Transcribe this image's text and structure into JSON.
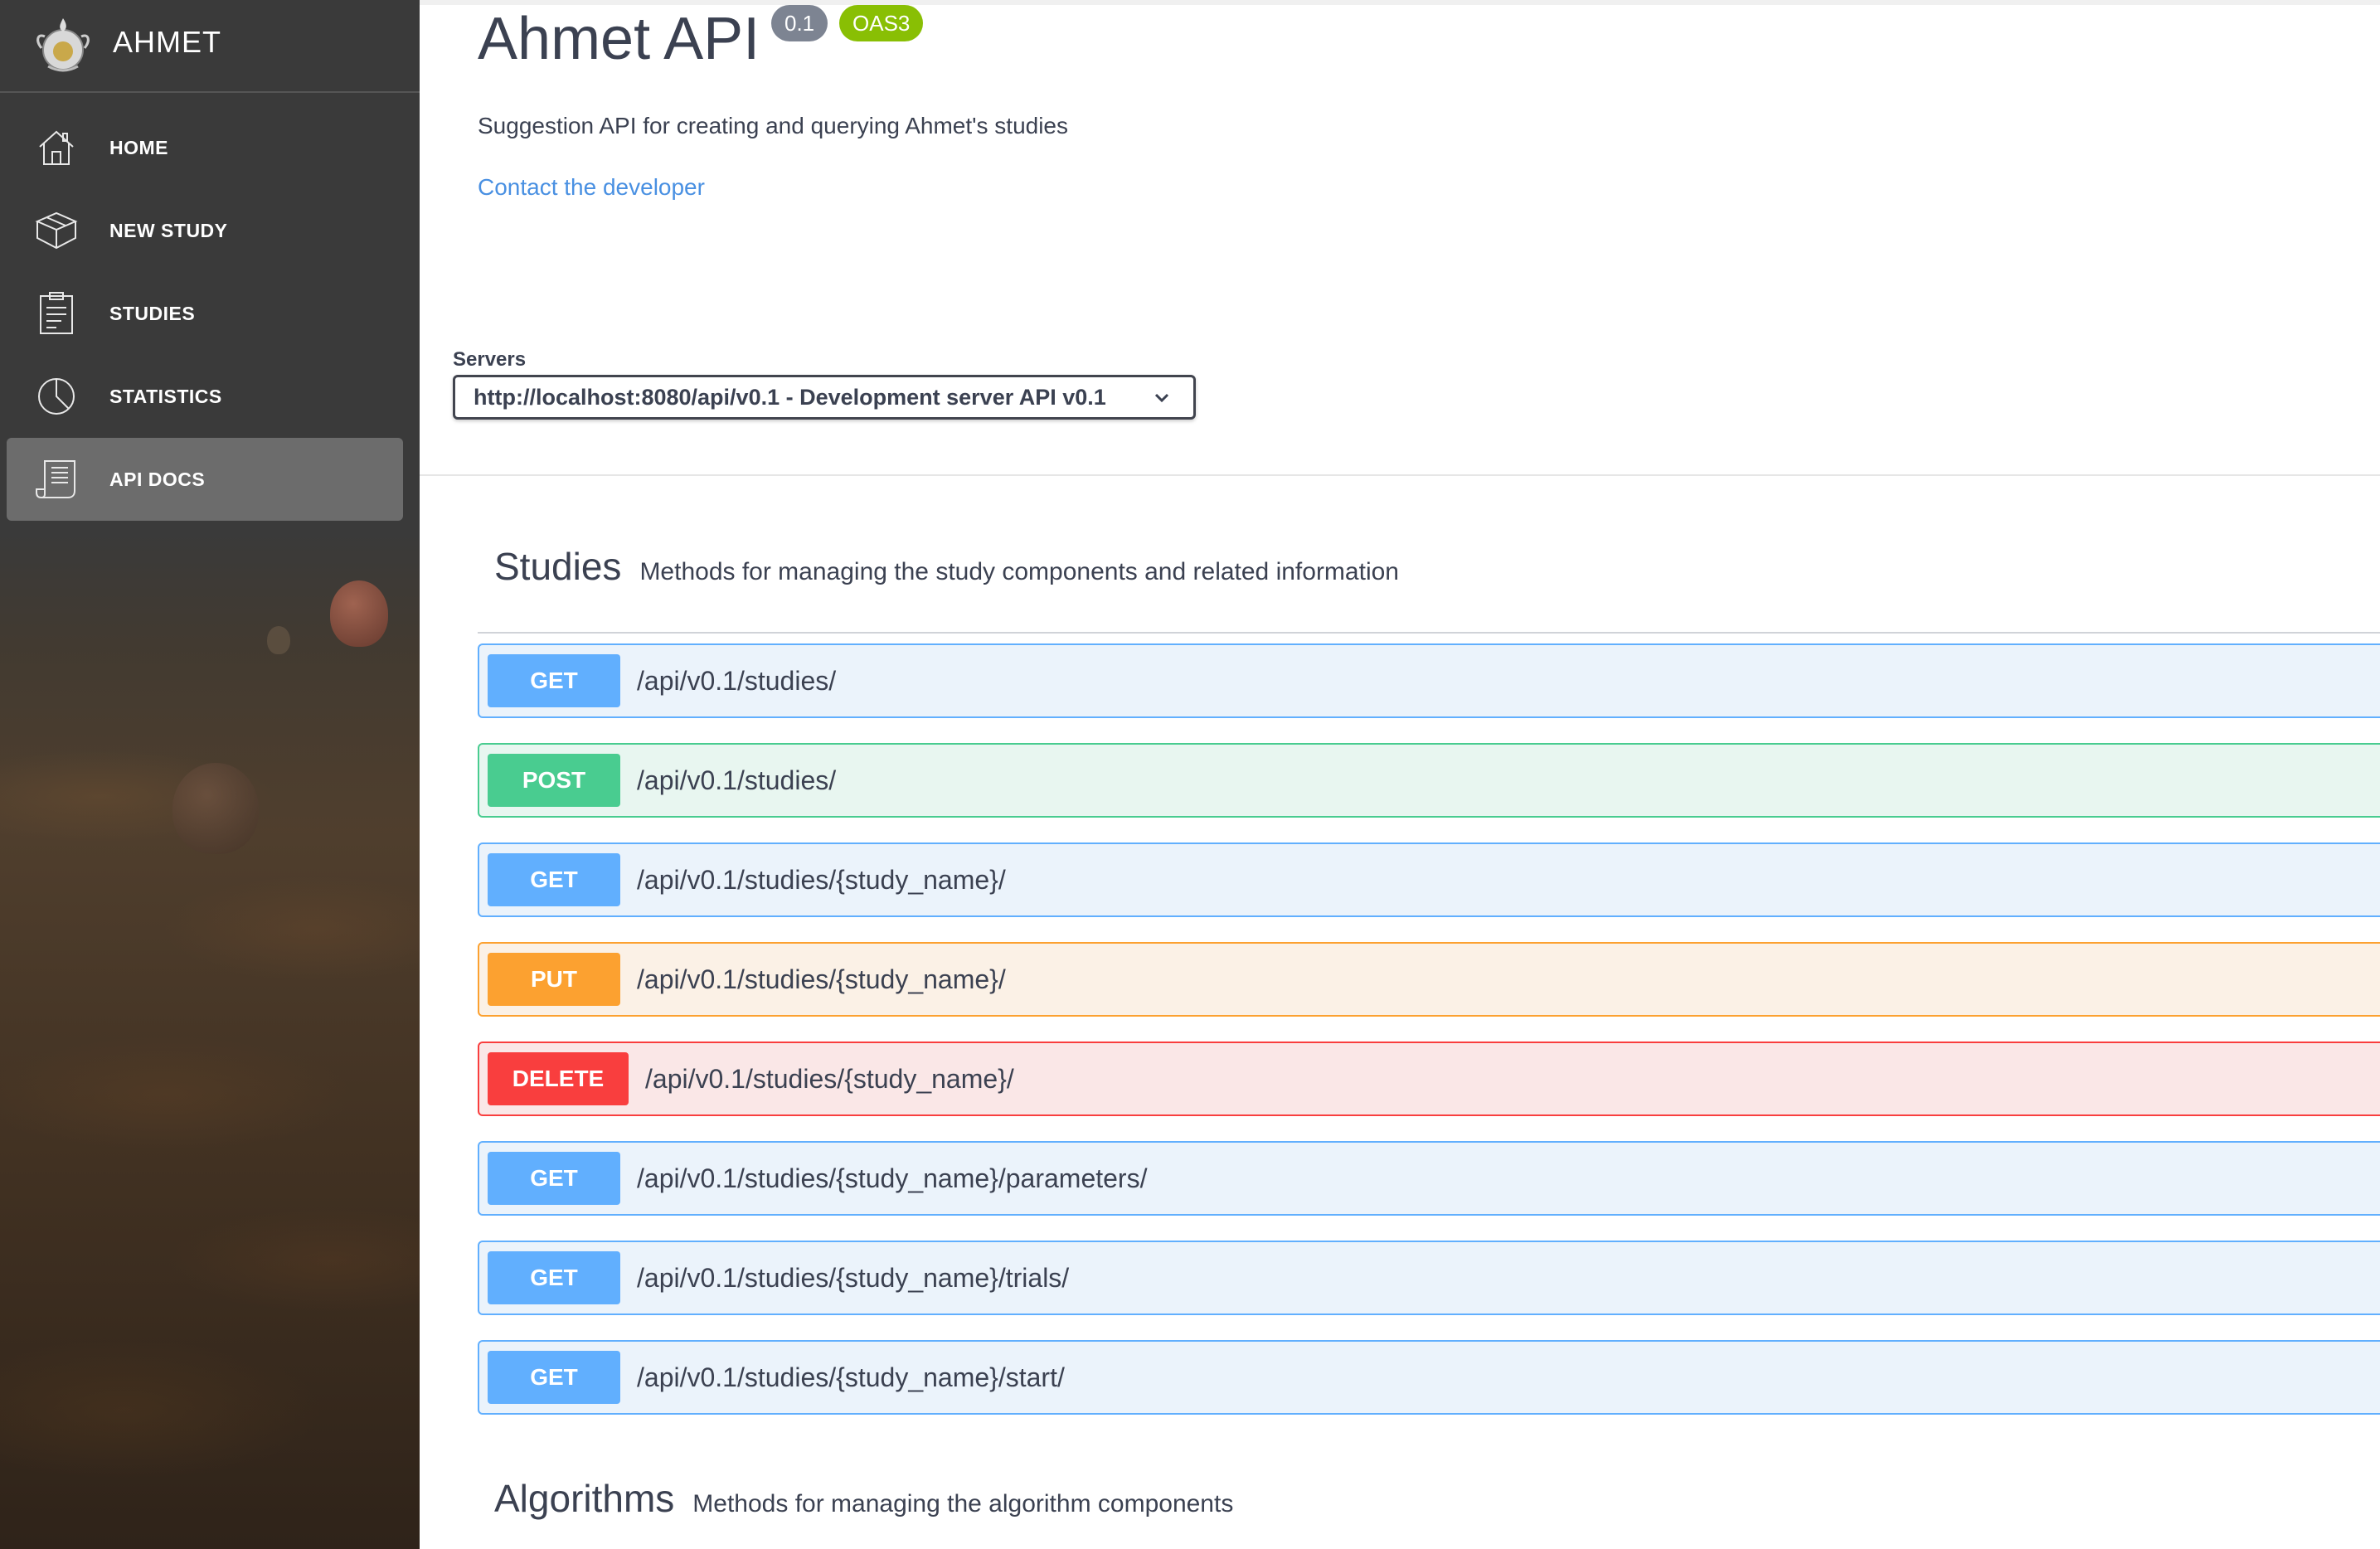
{
  "sidebar": {
    "brand": "AHMET",
    "items": [
      {
        "label": "HOME",
        "icon": "home-icon"
      },
      {
        "label": "NEW STUDY",
        "icon": "box-icon"
      },
      {
        "label": "STUDIES",
        "icon": "clipboard-icon"
      },
      {
        "label": "STATISTICS",
        "icon": "pie-chart-icon"
      },
      {
        "label": "API DOCS",
        "icon": "document-icon",
        "active": true
      }
    ]
  },
  "info": {
    "title": "Ahmet API",
    "version": "0.1",
    "oas": "OAS3",
    "description": "Suggestion API for creating and querying Ahmet's studies",
    "contact": "Contact the developer"
  },
  "servers": {
    "label": "Servers",
    "selected": "http://localhost:8080/api/v0.1 - Development server API v0.1"
  },
  "sections": [
    {
      "name": "Studies",
      "description": "Methods for managing the study components and related information",
      "operations": [
        {
          "method": "GET",
          "path": "/api/v0.1/studies/"
        },
        {
          "method": "POST",
          "path": "/api/v0.1/studies/"
        },
        {
          "method": "GET",
          "path": "/api/v0.1/studies/{study_name}/"
        },
        {
          "method": "PUT",
          "path": "/api/v0.1/studies/{study_name}/"
        },
        {
          "method": "DELETE",
          "path": "/api/v0.1/studies/{study_name}/"
        },
        {
          "method": "GET",
          "path": "/api/v0.1/studies/{study_name}/parameters/"
        },
        {
          "method": "GET",
          "path": "/api/v0.1/studies/{study_name}/trials/"
        },
        {
          "method": "GET",
          "path": "/api/v0.1/studies/{study_name}/start/"
        }
      ]
    },
    {
      "name": "Algorithms",
      "description": "Methods for managing the algorithm components"
    }
  ],
  "colors": {
    "get": "#61affe",
    "post": "#49cc90",
    "put": "#fca130",
    "delete": "#f93e3e",
    "link": "#4990e2"
  }
}
